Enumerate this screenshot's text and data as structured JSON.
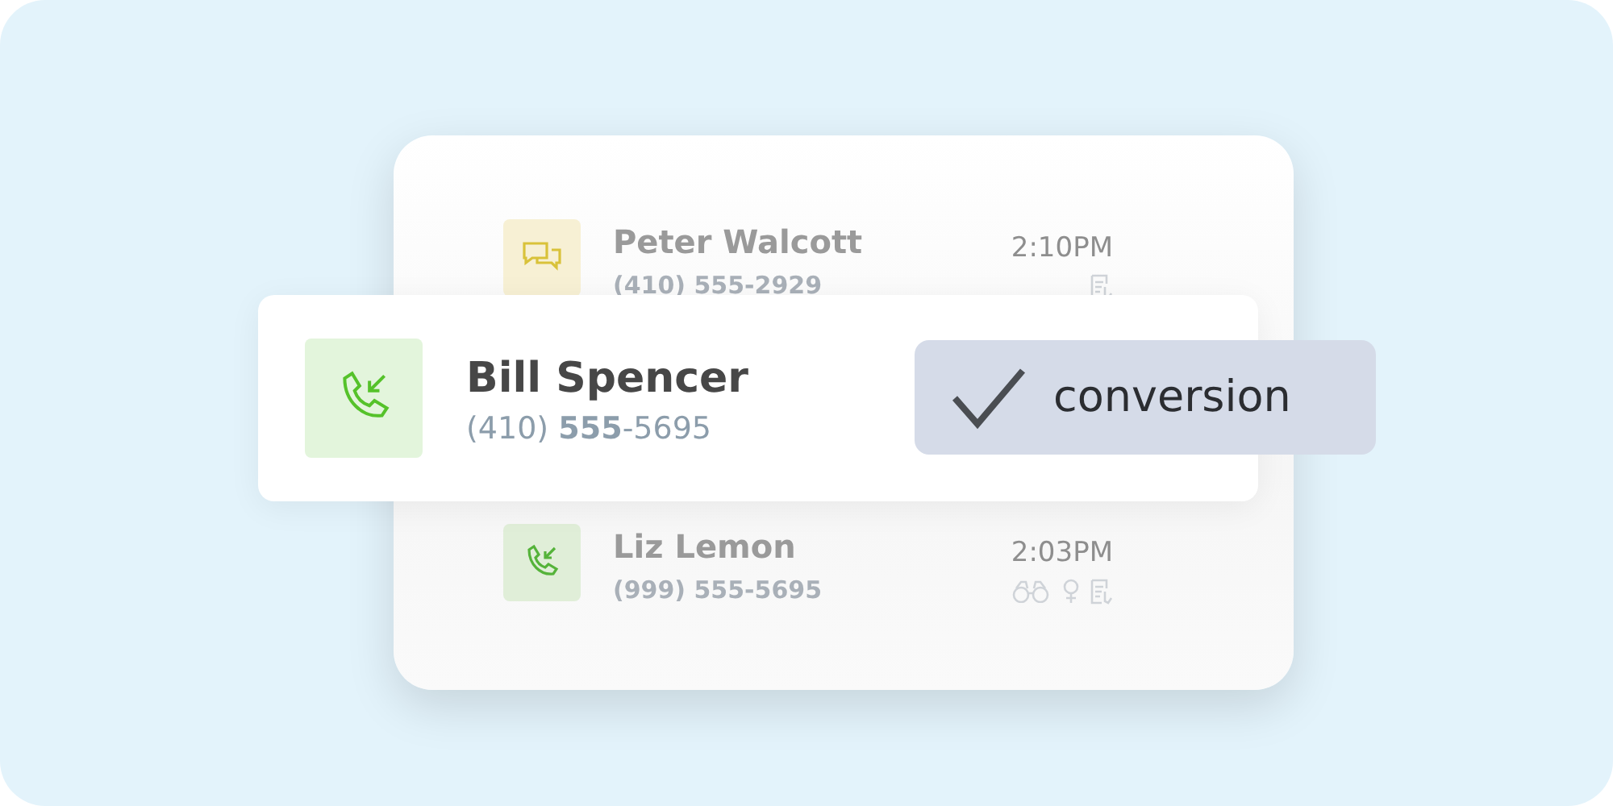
{
  "calls": [
    {
      "name": "Peter Walcott",
      "phone": "(410) 555-2929",
      "time": "2:10PM",
      "kind": "chat",
      "tags": [
        {
          "kind": "note"
        }
      ]
    },
    {
      "name": "Liz Lemon",
      "phone": "(999) 555-5695",
      "time": "2:03PM",
      "kind": "call",
      "tags": [
        {
          "kind": "binoculars"
        },
        {
          "kind": "female"
        },
        {
          "kind": "note"
        }
      ]
    }
  ],
  "highlight": {
    "name": "Bill Spencer",
    "phone": "(410) **555**-5695",
    "kind": "call"
  },
  "badge": {
    "label": "conversion"
  }
}
